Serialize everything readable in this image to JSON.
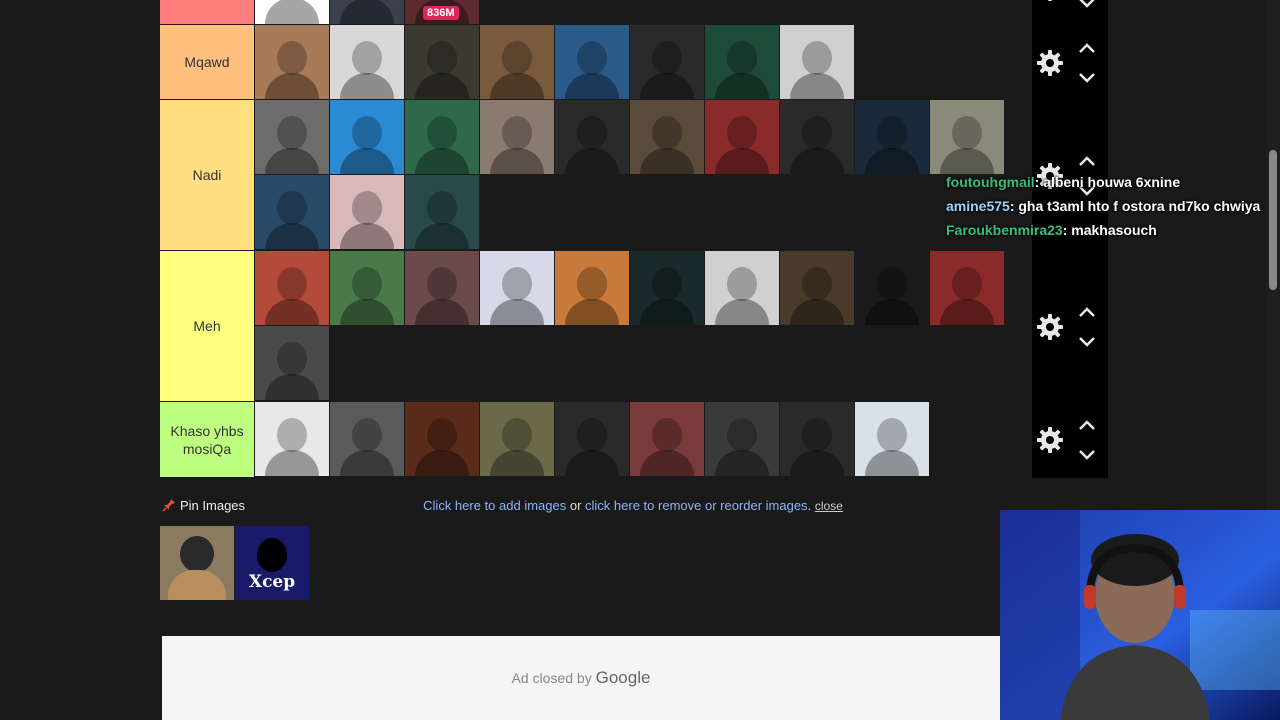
{
  "tiers": [
    {
      "label": "",
      "color": "#ff7f7f",
      "items": [
        {
          "color": "#ffffff"
        },
        {
          "color": "#3a4050"
        },
        {
          "color": "#5c2a2f",
          "badge": "836M"
        }
      ]
    },
    {
      "label": "Mqawd",
      "color": "#ffbf7f",
      "items": [
        {
          "color": "#a87a58"
        },
        {
          "color": "#d8d8d8"
        },
        {
          "color": "#3b3a30"
        },
        {
          "color": "#7a5a3c"
        },
        {
          "color": "#2a5a8a"
        },
        {
          "color": "#2a2a2a"
        },
        {
          "color": "#1e4a3a"
        },
        {
          "color": "#cfcfcf"
        }
      ]
    },
    {
      "label": "Nadi",
      "color": "#ffdf80",
      "items": [
        {
          "color": "#6c6c6c"
        },
        {
          "color": "#2b8ad4"
        },
        {
          "color": "#2e6a4a"
        },
        {
          "color": "#8a7a70"
        },
        {
          "color": "#2a2a2a"
        },
        {
          "color": "#5a4a3a"
        },
        {
          "color": "#8a2a2a"
        },
        {
          "color": "#2a2a2a"
        },
        {
          "color": "#1a2a3a"
        },
        {
          "color": "#8a8a7a"
        },
        {
          "color": "#2a4a6a"
        },
        {
          "color": "#d8b8b8"
        },
        {
          "color": "#2a4a4a"
        }
      ]
    },
    {
      "label": "Meh",
      "color": "#ffff7f",
      "items": [
        {
          "color": "#b44a3a"
        },
        {
          "color": "#4a7a4a"
        },
        {
          "color": "#6a4a4a"
        },
        {
          "color": "#d8d8e8"
        },
        {
          "color": "#c87a3a"
        },
        {
          "color": "#1a2a2a"
        },
        {
          "color": "#d0d0d0"
        },
        {
          "color": "#4a3a2a"
        },
        {
          "color": "#1a1a1a"
        },
        {
          "color": "#8a2a2a"
        },
        {
          "color": "#4a4a4a"
        }
      ]
    },
    {
      "label": "Khaso yhbs mosiQa",
      "color": "#bfff7f",
      "items": [
        {
          "color": "#e8e8e8"
        },
        {
          "color": "#5a5a5a"
        },
        {
          "color": "#5a2a1a"
        },
        {
          "color": "#6a6a4a"
        },
        {
          "color": "#2a2a2a"
        },
        {
          "color": "#7a3a3a"
        },
        {
          "color": "#3a3a3a"
        },
        {
          "color": "#2a2a2a"
        },
        {
          "color": "#d8e0e8"
        }
      ]
    }
  ],
  "pin": {
    "label": "Pin Images",
    "icon": "pin-icon",
    "images": [
      {
        "color": "#8a7a60"
      },
      {
        "color": "#1a1a6a",
        "text": "Xcep"
      }
    ]
  },
  "add_images": {
    "link1": "Click here to add images",
    "or": " or ",
    "link2": "click here to remove or reorder images",
    "period": ".",
    "close": "close"
  },
  "ad": {
    "closed_by": "Ad closed by",
    "brand": "Google"
  },
  "chat": [
    {
      "user": "foutouhgmail",
      "msg": ": albeni houwa 6xnine",
      "user_color": "#35c07b"
    },
    {
      "user": "amine575",
      "msg": ": gha t3aml hto f ostora nd7ko chwiya",
      "user_color": "#9fd3ff"
    },
    {
      "user": "Faroukbenmira23",
      "msg": ": makhasouch",
      "user_color": "#35c07b"
    }
  ],
  "colors": {
    "accent_link": "#8ab4f8",
    "background": "#1a1a1a"
  }
}
